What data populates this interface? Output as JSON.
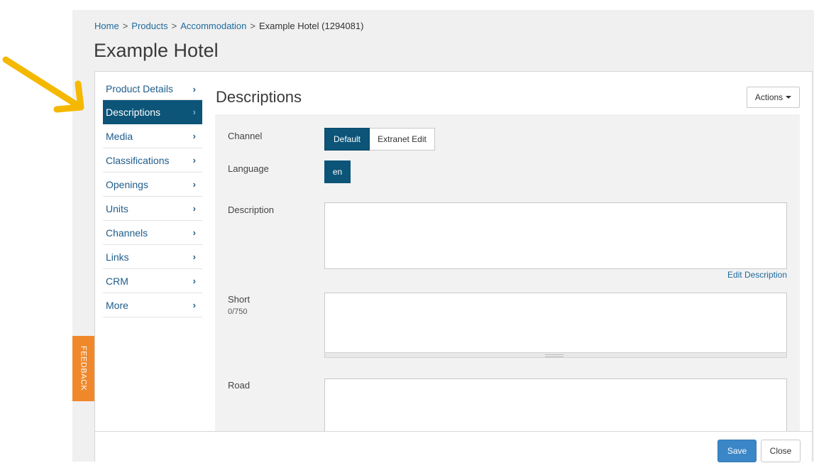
{
  "breadcrumb": {
    "items": [
      "Home",
      "Products",
      "Accommodation",
      "Example Hotel (1294081)"
    ],
    "separator": ">"
  },
  "page": {
    "title": "Example Hotel"
  },
  "sidebar": {
    "items": [
      {
        "label": "Product Details"
      },
      {
        "label": "Descriptions",
        "active": true
      },
      {
        "label": "Media"
      },
      {
        "label": "Classifications"
      },
      {
        "label": "Openings"
      },
      {
        "label": "Units"
      },
      {
        "label": "Channels"
      },
      {
        "label": "Links"
      },
      {
        "label": "CRM"
      },
      {
        "label": "More"
      }
    ],
    "chevron": "›"
  },
  "main": {
    "title": "Descriptions",
    "actions_label": "Actions"
  },
  "form": {
    "channel_label": "Channel",
    "channel_options": [
      "Default",
      "Extranet Edit"
    ],
    "channel_selected": "Default",
    "language_label": "Language",
    "language_value": "en",
    "description_label": "Description",
    "description_value": "",
    "edit_description_link": "Edit Description",
    "short_label": "Short",
    "short_counter": "0/750",
    "short_value": "",
    "road_label": "Road",
    "road_value": ""
  },
  "footer": {
    "save_label": "Save",
    "close_label": "Close"
  },
  "feedback": {
    "label": "FEEDBACK"
  },
  "colors": {
    "active_nav": "#0c5478",
    "link": "#1f6a9c",
    "save": "#3a86c6",
    "feedback": "#f0882b",
    "annotation_arrow": "#f5b800"
  },
  "icons": [
    "chevron-right-icon",
    "caret-down-icon",
    "scroll-up-icon",
    "scroll-down-icon",
    "annotation-arrow-icon"
  ]
}
